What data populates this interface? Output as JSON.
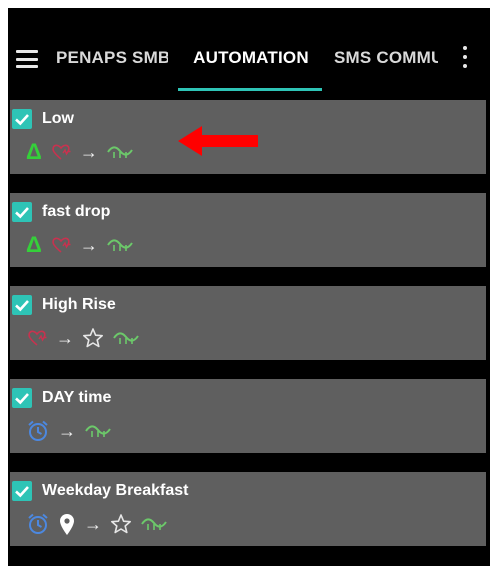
{
  "topbar": {
    "tabs": [
      {
        "label": "PENAPS SMB"
      },
      {
        "label": "AUTOMATION"
      },
      {
        "label": "SMS COMMU"
      }
    ],
    "active_tab": "AUTOMATION"
  },
  "rules": [
    {
      "title": "Low",
      "enabled": true,
      "icons": [
        "delta-icon",
        "heart-rate-icon",
        "arrow-right-icon",
        "profile-switch-icon"
      ]
    },
    {
      "title": "fast drop",
      "enabled": true,
      "icons": [
        "delta-icon",
        "heart-rate-icon",
        "arrow-right-icon",
        "profile-switch-icon"
      ]
    },
    {
      "title": "High Rise",
      "enabled": true,
      "icons": [
        "heart-rate-icon",
        "arrow-right-icon",
        "star-icon",
        "profile-switch-icon"
      ]
    },
    {
      "title": "DAY time",
      "enabled": true,
      "icons": [
        "alarm-clock-icon",
        "arrow-right-icon",
        "profile-switch-icon"
      ]
    },
    {
      "title": "Weekday Breakfast",
      "enabled": true,
      "icons": [
        "alarm-clock-icon",
        "location-pin-icon",
        "arrow-right-icon",
        "star-icon",
        "profile-switch-icon"
      ]
    }
  ],
  "colors": {
    "accent": "#2ec4b6",
    "card": "#5f5f5f",
    "delta": "#35d03a",
    "heart": "#c8324f",
    "switch": "#6cc96a",
    "alarm": "#4c88e0",
    "annotation_arrow": "#ff0000"
  }
}
